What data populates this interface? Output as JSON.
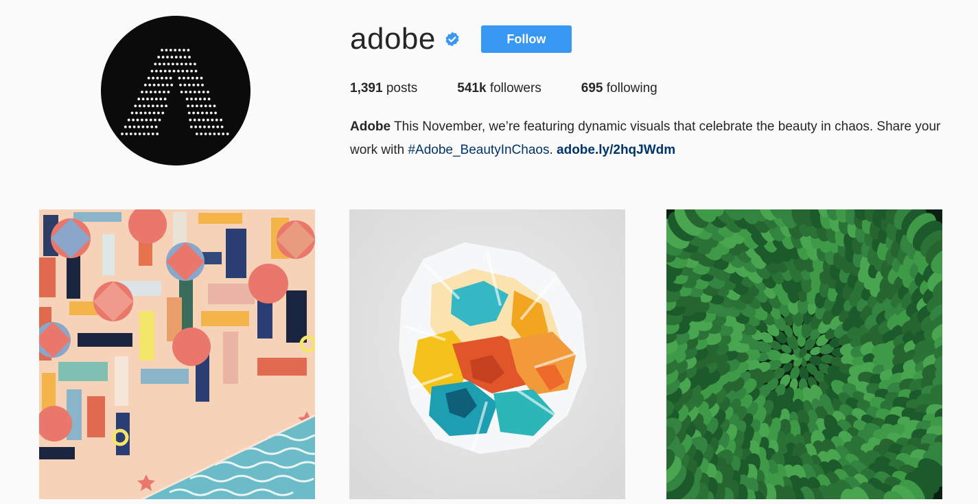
{
  "profile": {
    "username": "adobe",
    "verified": true,
    "follow_label": "Follow",
    "avatar_icon": "adobe-logo-icon",
    "verified_icon": "verified-badge-icon"
  },
  "stats": {
    "posts_count": "1,391",
    "posts_label": "posts",
    "followers_count": "541k",
    "followers_label": "followers",
    "following_count": "695",
    "following_label": "following"
  },
  "bio": {
    "name": "Adobe",
    "text_part1": " This November, we’re featuring dynamic visuals that celebrate the beauty in chaos. Share your work with ",
    "hashtag": "#Adobe_BeautyInChaos",
    "text_part2": ". ",
    "link": "adobe.ly/2hqJWdm"
  },
  "colors": {
    "accent": "#3897f0",
    "link": "#003569",
    "background": "#fafafa"
  },
  "posts": [
    {
      "subject": "beach-illustration"
    },
    {
      "subject": "crumpled-painted-paper"
    },
    {
      "subject": "aerial-forest"
    }
  ]
}
